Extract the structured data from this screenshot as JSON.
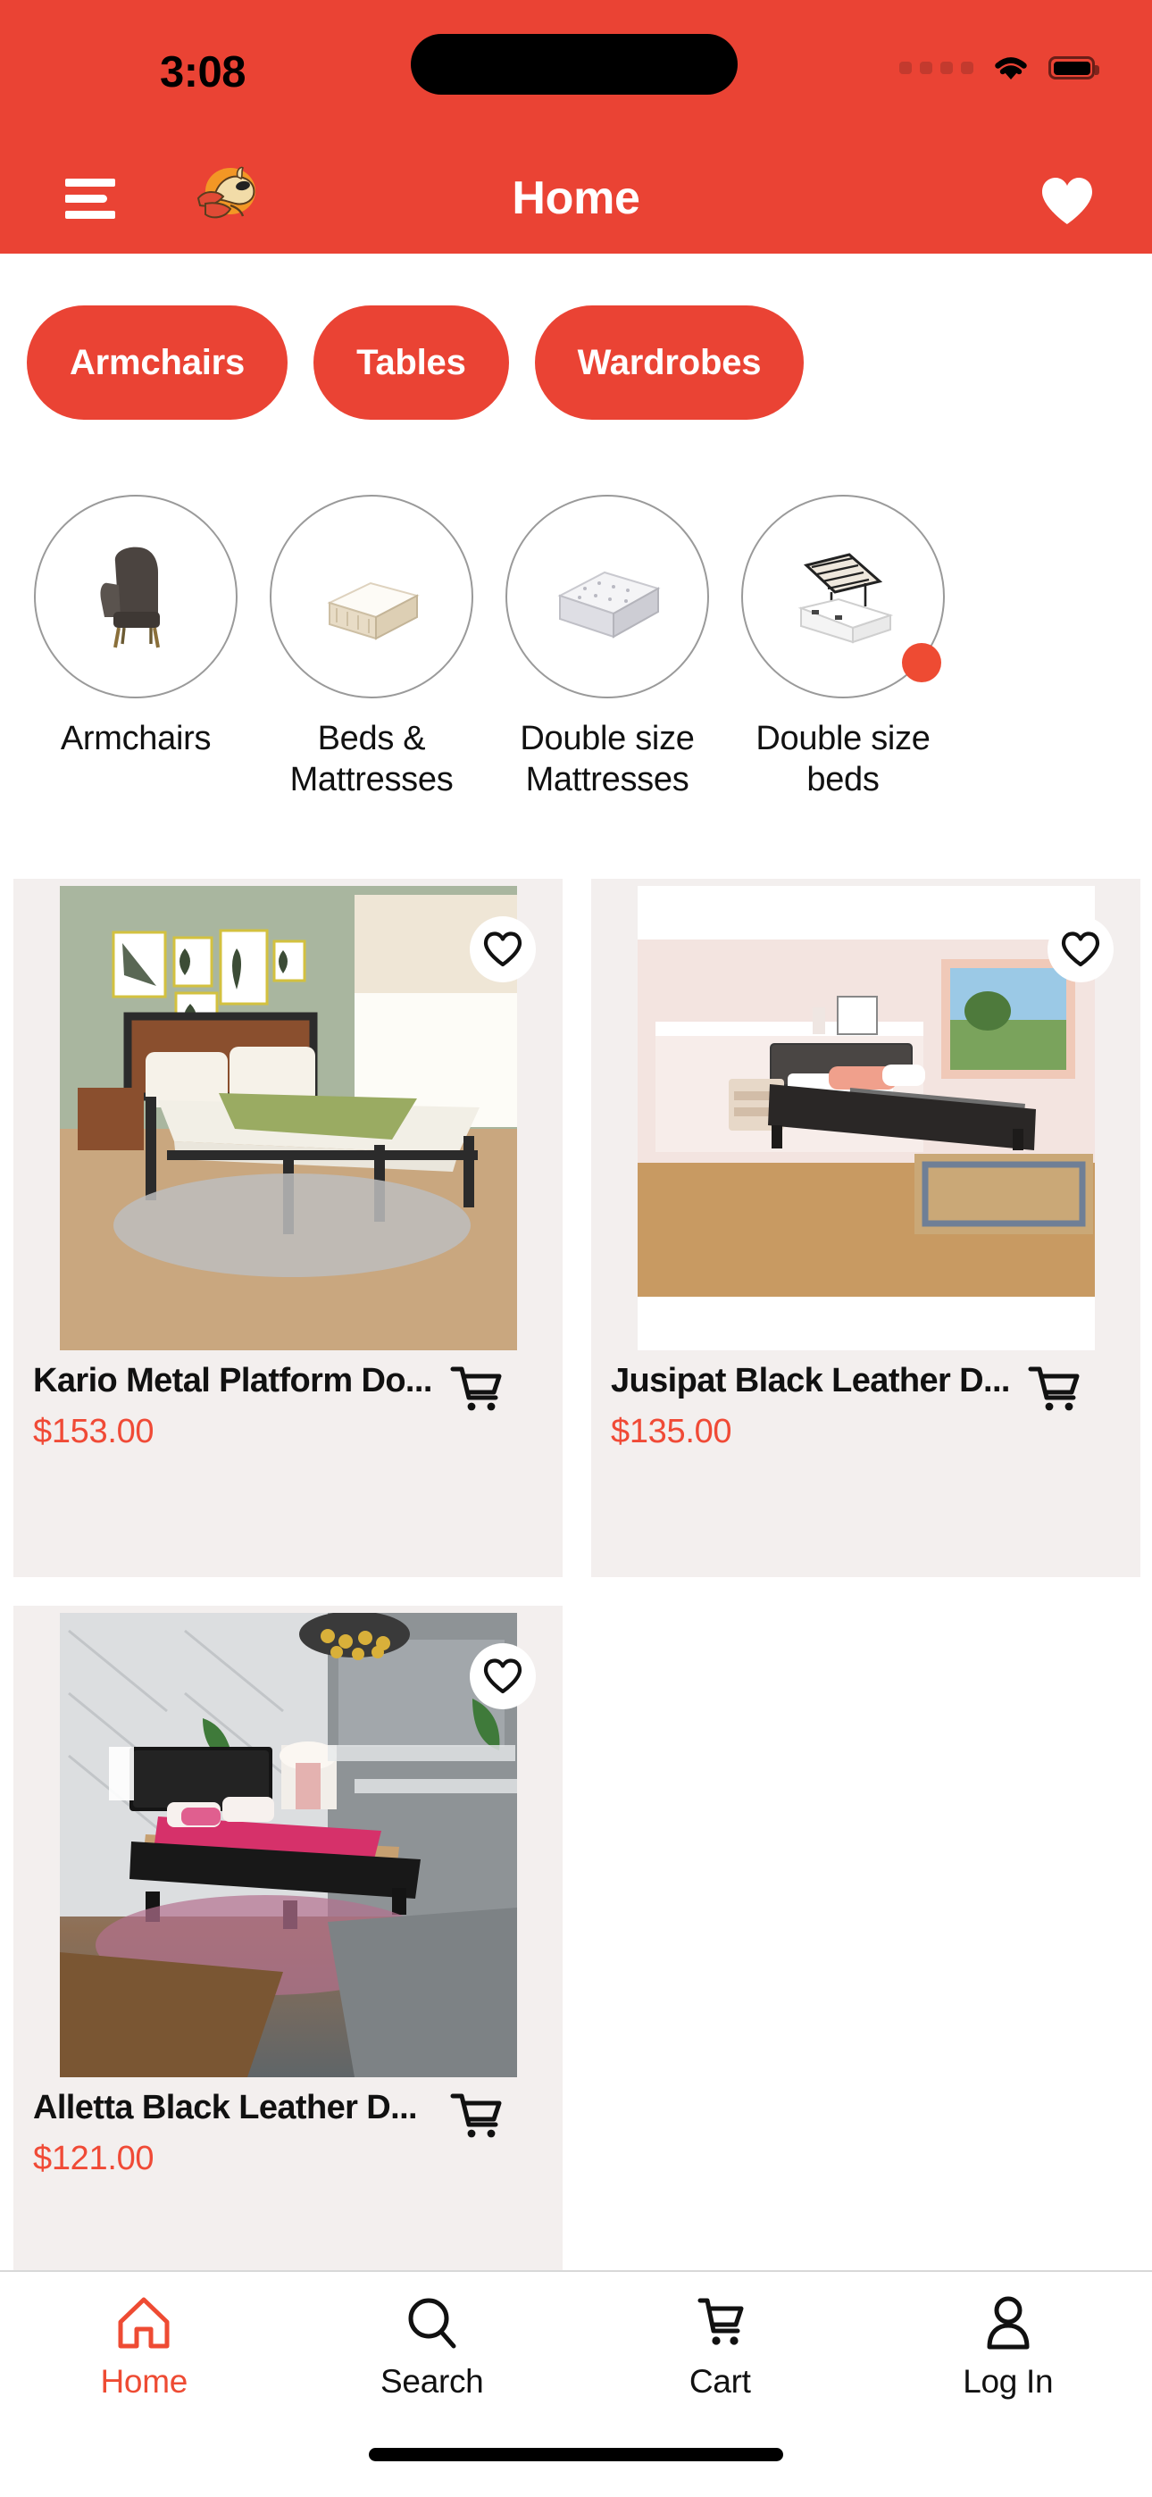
{
  "status_bar": {
    "time": "3:08",
    "cellular_icon": "signal-dots-icon",
    "wifi_icon": "wifi-icon",
    "battery_icon": "battery-icon"
  },
  "header": {
    "menu_icon": "hamburger-menu-icon",
    "logo_icon": "camel-logo-icon",
    "title": "Home",
    "favorites_icon": "heart-filled-icon"
  },
  "colors": {
    "brand_red": "#EA4334",
    "price_red": "#F04A36",
    "card_bg": "#F3EFEE",
    "page_bg": "#FFFFFF",
    "badge_red": "#EE4B33"
  },
  "filter_pills": [
    {
      "label": "Armchairs"
    },
    {
      "label": "Tables"
    },
    {
      "label": "Wardrobes"
    }
  ],
  "categories": [
    {
      "label": "Armchairs",
      "icon": "armchair-thumbnail",
      "badge": false
    },
    {
      "label": "Beds & Mattresses",
      "icon": "mattress-beige-thumbnail",
      "badge": false
    },
    {
      "label": "Double size Mattresses",
      "icon": "mattress-grey-thumbnail",
      "badge": false
    },
    {
      "label": "Double size beds",
      "icon": "ottoman-bed-thumbnail",
      "badge": true
    }
  ],
  "products": [
    {
      "title": "Kario Metal Platform Do...",
      "price": "$153.00",
      "image_alt": "metal platform bed in green bedroom",
      "favorite_icon": "heart-outline-icon",
      "cart_icon": "shopping-cart-icon"
    },
    {
      "title": "Jusipat Black Leather D...",
      "price": "$135.00",
      "image_alt": "black leather bed in pink bedroom",
      "favorite_icon": "heart-outline-icon",
      "cart_icon": "shopping-cart-icon"
    },
    {
      "title": "Alletta Black Leather D...",
      "price": "$121.00",
      "image_alt": "black leather bed with pink bedding",
      "favorite_icon": "heart-outline-icon",
      "cart_icon": "shopping-cart-icon"
    }
  ],
  "bottom_nav": [
    {
      "label": "Home",
      "icon": "home-icon",
      "active": true
    },
    {
      "label": "Search",
      "icon": "search-icon",
      "active": false
    },
    {
      "label": "Cart",
      "icon": "cart-icon",
      "active": false
    },
    {
      "label": "Log In",
      "icon": "person-icon",
      "active": false
    }
  ]
}
